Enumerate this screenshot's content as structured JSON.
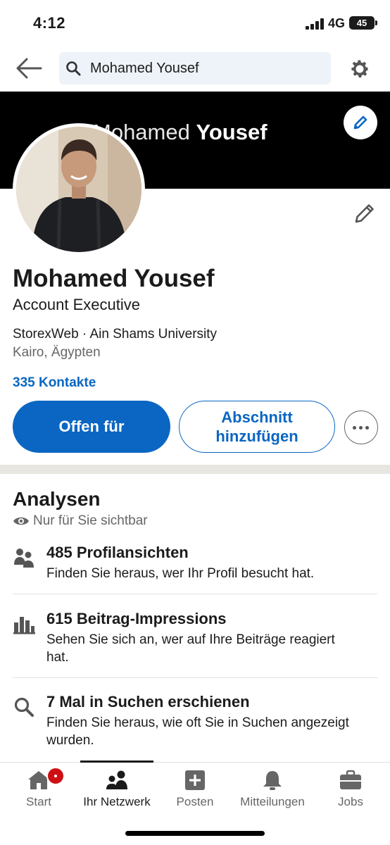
{
  "status_bar": {
    "time": "4:12",
    "network": "4G",
    "battery": "45"
  },
  "search": {
    "value": "Mohamed Yousef"
  },
  "banner": {
    "text_first": "Mohamed",
    "text_last": "Yousef",
    "background": "#000000"
  },
  "profile": {
    "name": "Mohamed Yousef",
    "headline": "Account Executive",
    "org_line": "StorexWeb · Ain Shams University",
    "location": "Kairo, Ägypten",
    "connections": "335 Kontakte"
  },
  "actions": {
    "primary_label": "Offen für",
    "secondary_label": "Abschnitt hinzufügen",
    "more_icon": "more-horizontal-icon"
  },
  "analytics": {
    "title": "Analysen",
    "visibility": "Nur für Sie sichtbar",
    "items": [
      {
        "icon": "people-icon",
        "title": "485 Profilansichten",
        "description": "Finden Sie heraus, wer Ihr Profil besucht hat."
      },
      {
        "icon": "bar-chart-icon",
        "title": "615 Beitrag-Impressions",
        "description": "Sehen Sie sich an, wer auf Ihre Beiträge reagiert hat."
      },
      {
        "icon": "search-icon",
        "title": "7 Mal in Suchen erschienen",
        "description": "Finden Sie heraus, wie oft Sie in Suchen angezeigt wurden."
      }
    ]
  },
  "bottom_nav": {
    "items": [
      {
        "label": "Start",
        "icon": "home-icon"
      },
      {
        "label": "Ihr Netzwerk",
        "icon": "network-icon",
        "active": true
      },
      {
        "label": "Posten",
        "icon": "plus-box-icon"
      },
      {
        "label": "Mitteilungen",
        "icon": "bell-icon"
      },
      {
        "label": "Jobs",
        "icon": "briefcase-icon"
      }
    ]
  },
  "colors": {
    "accent": "#0a66c2",
    "notification": "#cc1016",
    "section_divider": "#e8e6e1"
  }
}
